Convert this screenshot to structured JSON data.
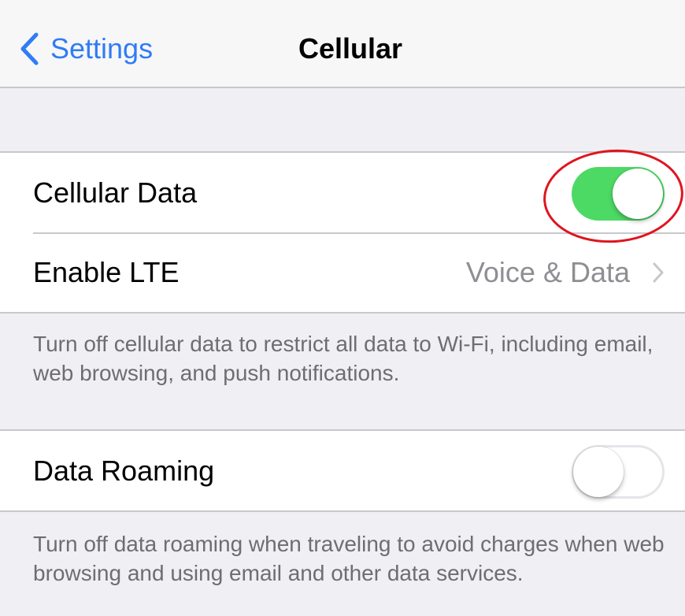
{
  "navbar": {
    "back_label": "Settings",
    "title": "Cellular"
  },
  "sections": {
    "cellular": {
      "data_row": {
        "label": "Cellular Data",
        "toggle_on": true
      },
      "lte_row": {
        "label": "Enable LTE",
        "value": "Voice & Data"
      },
      "footnote": "Turn off cellular data to restrict all data to Wi-Fi, including email, web browsing, and push notifications."
    },
    "roaming": {
      "row": {
        "label": "Data Roaming",
        "toggle_on": false
      },
      "footnote": "Turn off data roaming when traveling to avoid charges when web browsing and using email and other data services."
    }
  },
  "colors": {
    "accent": "#2f7cf6",
    "toggle_on": "#4cd964",
    "highlight": "#e0141e"
  },
  "icons": {
    "back": "chevron-left-icon",
    "disclosure": "chevron-right-icon"
  }
}
